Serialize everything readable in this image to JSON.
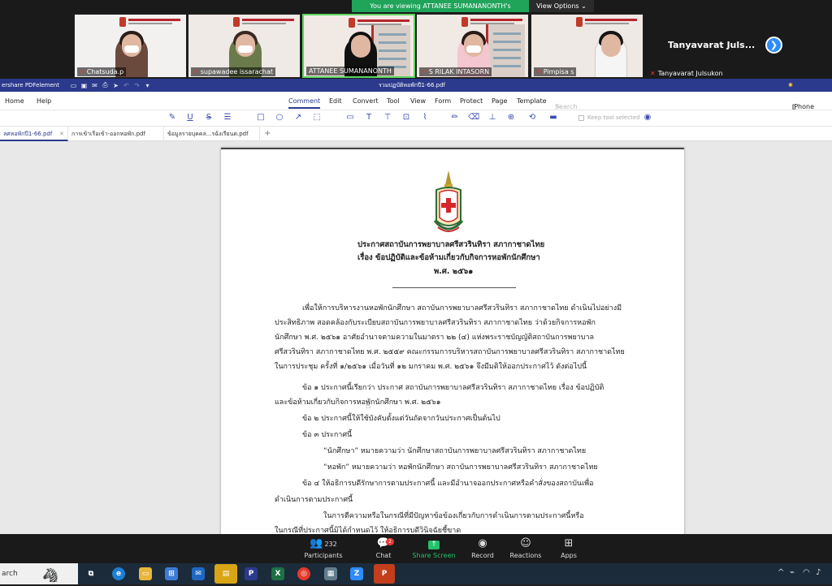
{
  "zoom": {
    "banner_text": "You are viewing ATTANEE SUMANANONTH's screen",
    "view_options": "View Options ⌄",
    "participants": [
      {
        "name": "Chatsuda.p"
      },
      {
        "name": "supawadee issarachat"
      },
      {
        "name": "ATTANEE SUMANANONTH"
      },
      {
        "name": "S RILAK INTASORN"
      },
      {
        "name": "Pimpisa s"
      },
      {
        "name": "Tanyavarat Julsukon",
        "label_big": "Tanyavarat  Juls..."
      }
    ],
    "toolbar": {
      "participants_count": "232",
      "participants": "Participants",
      "chat": "Chat",
      "chat_badge": "2",
      "share": "Share Screen",
      "record": "Record",
      "reactions": "Reactions",
      "apps": "Apps"
    }
  },
  "pdf": {
    "app_title": "ershare PDFelement",
    "doc_title": "รวมปฏบัติหอพักปี1-66.pdf",
    "menu": [
      "Home",
      "Help",
      "Comment",
      "Edit",
      "Convert",
      "Tool",
      "View",
      "Form",
      "Protect",
      "Page",
      "Template"
    ],
    "active_menu": "Comment",
    "search_placeholder": "Search Tools",
    "device_label": "iPhone / iPa",
    "keep_tool": "Keep tool selected",
    "tabs": [
      {
        "label": "ลศหอพักปี1-66.pdf",
        "active": true
      },
      {
        "label": "การเข้าเรือเข้า-ออกหอพัก.pdf",
        "active": false
      },
      {
        "label": "ข้อมูลรายบุคคล...รฉ้งเรียนต.pdf",
        "active": false
      }
    ]
  },
  "document": {
    "title_1": "ประกาศสถาบันการพยาบาลศรีสวรินทิรา สภากาชาดไทย",
    "title_2": "เรื่อง  ข้อปฏิบัติและข้อห้ามเกี่ยวกับกิจการหอพักนักศึกษา",
    "title_3": "พ.ศ. ๒๕๖๑",
    "p1": [
      "เพื่อให้การบริหารงานหอพักนักศึกษา สถาบันการพยาบาลศรีสวรินทิรา สภากาชาดไทย  ดำเนินไปอย่างมี",
      "ประสิทธิภาพ  สอดคล้องกับระเบียบสถาบันการพยาบาลศรีสวรินทิรา สภากาชาดไทย  ว่าด้วยกิจการหอพัก",
      "นักศึกษา พ.ศ. ๒๕๖๑ อาศัยอำนาจตามความในมาตรา ๒๒ (๔) แห่งพระราชบัญญัติสถาบันการพยาบาล",
      "ศรีสวรินทิรา สภากาชาดไทย พ.ศ. ๒๕๕๙ คณะกรรมการบริหารสถาบันการพยาบาลศรีสวรินทิรา สภากาชาดไทย",
      "ในการประชุม ครั้งที่ ๑/๒๕๖๑  เมื่อวันที่ ๑๒ มกราคม พ.ศ. ๒๕๖๑ จึงมีมติให้ออกประกาศไว้  ดังต่อไปนี้"
    ],
    "c1a": "ข้อ ๑ ประกาศนี้เรียกว่า ประกาศ สถาบันการพยาบาลศรีสวรินทิรา สภากาชาดไทย  เรื่อง  ข้อปฏิบัติ",
    "c1b": "และข้อห้ามเกี่ยวกับกิจการหอพักนักศึกษา พ.ศ. ๒๕๖๑",
    "c2": "ข้อ ๒ ประกาศนี้ให้ใช้บังคับตั้งแต่วันถัดจากวันประกาศเป็นต้นไป",
    "c3": "ข้อ ๓ ประกาศนี้",
    "d1": "“นักศึกษา”  หมายความว่า    นักศึกษาสถาบันการพยาบาลศรีสวรินทิรา สภากาชาดไทย",
    "d2": "“หอพัก”  หมายความว่า    หอพักนักศึกษา  สถาบันการพยาบาลศรีสวรินทิรา สภากาชาดไทย",
    "c4a": "ข้อ ๔ ให้อธิการบดีรักษาการตามประกาศนี้  และมีอำนาจออกประกาศหรือคำสั่งของสถาบันเพื่อ",
    "c4b": "ดำเนินการตามประกาศนี้",
    "c5a": "ในการตีความหรือในกรณีที่มีปัญหาข้อข้องเกี่ยวกับการดำเนินการตามประกาศนี้หรือ",
    "c5b": "ในกรณีที่ประกาศนี้มิได้กำหนดไว้  ให้อธิการบดีวินิจฉัยชี้ขาด"
  },
  "taskbar": {
    "search": "arch"
  }
}
